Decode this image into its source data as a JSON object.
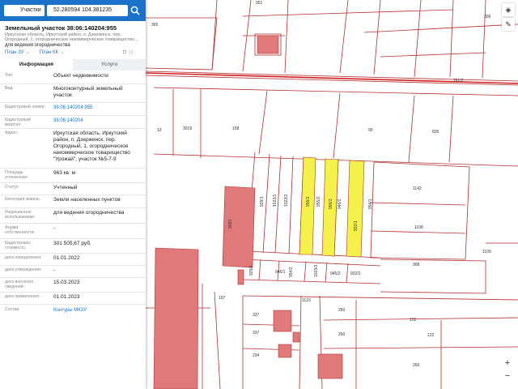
{
  "search": {
    "type_label": "Участки",
    "query": "52.280594 104.381235"
  },
  "parcel": {
    "title": "Земельный участок 38:06:140204:955",
    "address_short": "Иркутская область, Иркутский район, п. Дзержинск, пер. Огородный, 1, огородническое некоммерческое товарищество...",
    "purpose": "для ведения огородничества",
    "link_zu": "План ЗУ →",
    "link_kk": "План КК →"
  },
  "tabs": {
    "info": "Информация",
    "services": "Услуги"
  },
  "fields": [
    {
      "label": "Тип:",
      "value": "Объект недвижимости"
    },
    {
      "label": "Вид:",
      "value": "Многоконтурный земельный участок"
    },
    {
      "label": "Кадастровый номер:",
      "value": "38:06:140204:955",
      "link": true
    },
    {
      "label": "Кадастровый квартал:",
      "value": "38:06:140204",
      "link": true
    },
    {
      "label": "Адрес:",
      "value": "Иркутская область, Иркутский район, п. Дзержинск, пер. Огородный, 1, огородническое некоммерческое товарищество \"Урожай\", участок №5-7-9"
    },
    {
      "label": "Площадь уточненная:",
      "value": "963 кв. м"
    },
    {
      "label": "Статус:",
      "value": "Учтенный"
    },
    {
      "label": "Категория земель:",
      "value": "Земли населенных пунктов"
    },
    {
      "label": "Разрешенное использование:",
      "value": "для ведения огородничества"
    },
    {
      "label": "Форма собственности:",
      "value": "-"
    },
    {
      "label": "Кадастровая стоимость:",
      "value": "301 505,67 руб."
    },
    {
      "label": "дата определения:",
      "value": "01.01.2022"
    },
    {
      "label": "дата утверждения:",
      "value": "-"
    },
    {
      "label": "дата внесения сведений:",
      "value": "15.03.2023"
    },
    {
      "label": "дата применения:",
      "value": "01.01.2023"
    },
    {
      "label": "Состав:",
      "value": "Контуры МКЗУ",
      "link": true
    }
  ],
  "map_labels": {
    "road": "761/2",
    "b1": "13",
    "b2": "3019",
    "b3": "158",
    "b4": "90",
    "b5": "836",
    "b6": "1142",
    "b7": "1108",
    "b8": "908",
    "b9": "1109",
    "p1": "929/1",
    "p2": "1023/1",
    "p3": "1023/2",
    "p4": "955/1",
    "p5": "955/2",
    "p6": "946/2",
    "p7": "955/3",
    "p8": "932/1",
    "p9": "954/1",
    "r1": "929/2",
    "r2": "946/1",
    "r3": "954/2",
    "r4": "1023/3",
    "r5": "945/2",
    "r6": "932/2",
    "s1": "337",
    "s2": "337",
    "s3": "234",
    "s4": "260",
    "s5": "260",
    "s6": "1123",
    "s7": "152",
    "s8": "260",
    "s9": "197",
    "s10": "122",
    "t1": "951",
    "t2": "306",
    "t3": "365",
    "t4": "3093"
  },
  "colors": {
    "accent": "#1a73c9",
    "selected": "#f4f14a",
    "building": "#e07a7a",
    "line": "#b03030"
  },
  "icons": [
    "search-icon",
    "layers-icon",
    "pencil-icon",
    "bookmark-icon",
    "star-icon",
    "zoom-in-icon",
    "zoom-out-icon"
  ]
}
